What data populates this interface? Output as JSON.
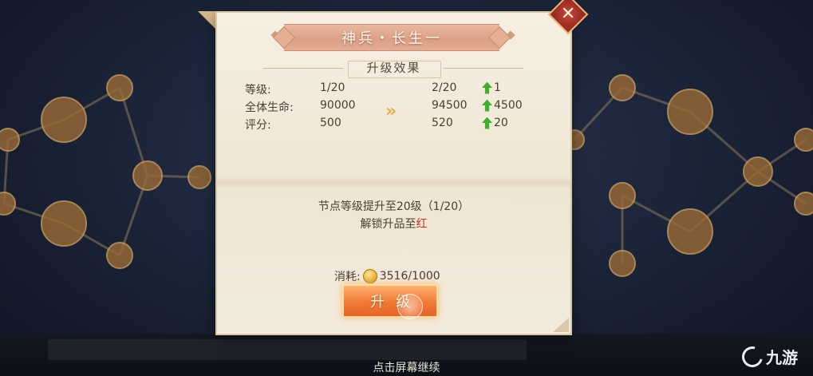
{
  "dialog": {
    "title": "神兵・长生一",
    "section_title": "升级效果",
    "stats": [
      {
        "label": "等级:",
        "old": "1/20",
        "new": "2/20",
        "increase": "1"
      },
      {
        "label": "全体生命:",
        "old": "90000",
        "new": "94500",
        "increase": "4500"
      },
      {
        "label": "评分:",
        "old": "500",
        "new": "520",
        "increase": "20"
      }
    ],
    "desc_line1": "节点等级提升至20级（1/20）",
    "desc_line2_prefix": "解锁升品至",
    "desc_line2_highlight": "红",
    "cost_label": "消耗:",
    "cost_value": "3516/1000",
    "upgrade_label": "升级",
    "close_icon": "close-icon"
  },
  "footer": {
    "continue_text": "点击屏幕继续",
    "watermark": "九游"
  },
  "colors": {
    "accent_red": "#d22a1c",
    "increase_green": "#3fae2f",
    "button_orange": "#f07a35"
  }
}
